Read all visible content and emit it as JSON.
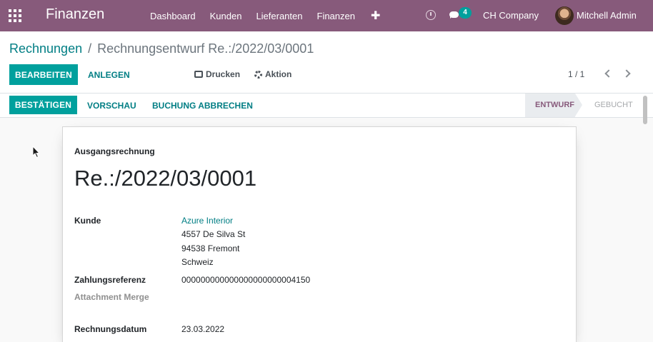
{
  "navbar": {
    "brand": "Finanzen",
    "menu": [
      "Dashboard",
      "Kunden",
      "Lieferanten",
      "Finanzen"
    ],
    "plus": "✚",
    "messages_count": "4",
    "company": "CH Company",
    "user": "Mitchell Admin"
  },
  "breadcrumb": {
    "parent": "Rechnungen",
    "separator": "/",
    "current": "Rechnungsentwurf Re.:/2022/03/0001"
  },
  "toolbar": {
    "edit_label": "BEARBEITEN",
    "create_label": "ANLEGEN",
    "print_label": "Drucken",
    "action_label": "Aktion",
    "pager": "1 / 1"
  },
  "statusbar": {
    "confirm_label": "BESTÄTIGEN",
    "preview_label": "VORSCHAU",
    "cancel_label": "BUCHUNG ABBRECHEN",
    "steps": [
      "ENTWURF",
      "GEBUCHT"
    ],
    "active_step": "ENTWURF"
  },
  "sheet": {
    "doc_type": "Ausgangsrechnung",
    "doc_number": "Re.:/2022/03/0001",
    "fields": {
      "customer_label": "Kunde",
      "customer_name": "Azure Interior",
      "customer_street": "4557 De Silva St",
      "customer_city": "94538 Fremont",
      "customer_country": "Schweiz",
      "payment_ref_label": "Zahlungsreferenz",
      "payment_ref_value": "000000000000000000000004150",
      "attachment_merge_label": "Attachment Merge",
      "invoice_date_label": "Rechnungsdatum",
      "invoice_date_value": "23.03.2022"
    }
  },
  "colors": {
    "navbar": "#875a7b",
    "primary": "#00a09d",
    "link": "#017e84"
  },
  "icons": [
    "apps-grid-icon",
    "plus-icon",
    "clock-icon",
    "chat-icon",
    "printer-icon",
    "gear-icon",
    "chevron-left-icon",
    "chevron-right-icon"
  ]
}
